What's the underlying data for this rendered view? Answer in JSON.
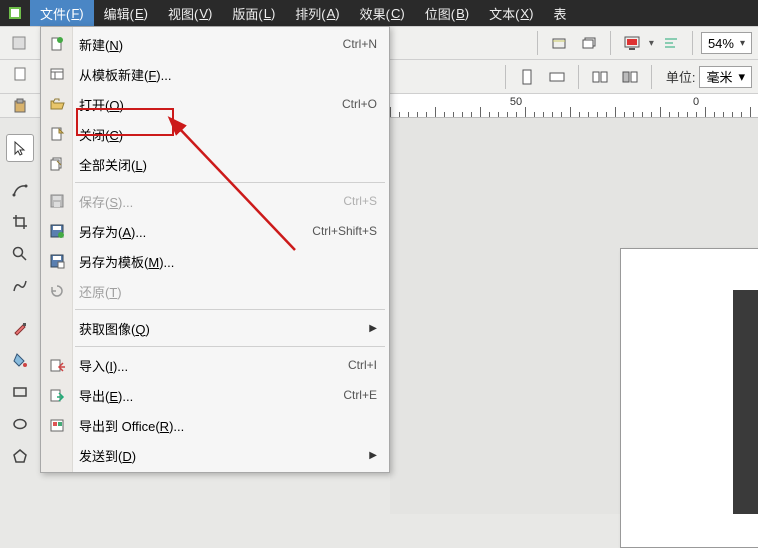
{
  "menubar": {
    "items": [
      {
        "label": "文件",
        "hot": "F"
      },
      {
        "label": "编辑",
        "hot": "E"
      },
      {
        "label": "视图",
        "hot": "V"
      },
      {
        "label": "版面",
        "hot": "L"
      },
      {
        "label": "排列",
        "hot": "A"
      },
      {
        "label": "效果",
        "hot": "C"
      },
      {
        "label": "位图",
        "hot": "B"
      },
      {
        "label": "文本",
        "hot": "X"
      },
      {
        "label": "表",
        "hot": ""
      }
    ],
    "active_index": 0
  },
  "toolbar_row1": {
    "zoom_value": "54%"
  },
  "toolbar_row2": {
    "unit_label": "单位:",
    "unit_value": "毫米"
  },
  "ruler": {
    "labels": [
      "50",
      "0"
    ],
    "positions": [
      0.35,
      0.85
    ]
  },
  "dropdown": {
    "items": [
      {
        "icon": "new",
        "label": "新建",
        "hot": "N",
        "shortcut": "Ctrl+N"
      },
      {
        "icon": "template",
        "label": "从模板新建",
        "hot": "F",
        "ellipsis": true
      },
      {
        "icon": "open",
        "label": "打开",
        "hot": "O",
        "ellipsis": true,
        "shortcut": "Ctrl+O"
      },
      {
        "icon": "close",
        "label": "关闭",
        "hot": "C"
      },
      {
        "icon": "closeall",
        "label": "全部关闭",
        "hot": "L"
      },
      {
        "sep": true
      },
      {
        "icon": "save",
        "label": "保存",
        "hot": "S",
        "ellipsis": true,
        "shortcut": "Ctrl+S",
        "disabled": true
      },
      {
        "icon": "saveas",
        "label": "另存为",
        "hot": "A",
        "ellipsis": true,
        "shortcut": "Ctrl+Shift+S"
      },
      {
        "icon": "savetpl",
        "label": "另存为模板",
        "hot": "M",
        "ellipsis": true
      },
      {
        "icon": "revert",
        "label": "还原",
        "hot": "T",
        "disabled": true
      },
      {
        "sep": true
      },
      {
        "icon": "acquire",
        "label": "获取图像",
        "hot": "Q",
        "submenu": true
      },
      {
        "sep": true
      },
      {
        "icon": "import",
        "label": "导入",
        "hot": "I",
        "ellipsis": true,
        "shortcut": "Ctrl+I"
      },
      {
        "icon": "export",
        "label": "导出",
        "hot": "E",
        "ellipsis": true,
        "shortcut": "Ctrl+E"
      },
      {
        "icon": "exportoffice",
        "label": "导出到 Office",
        "hot": "R",
        "ellipsis": true
      },
      {
        "icon": "",
        "label": "发送到",
        "hot": "D",
        "submenu": true
      }
    ],
    "highlight_index": 2
  }
}
